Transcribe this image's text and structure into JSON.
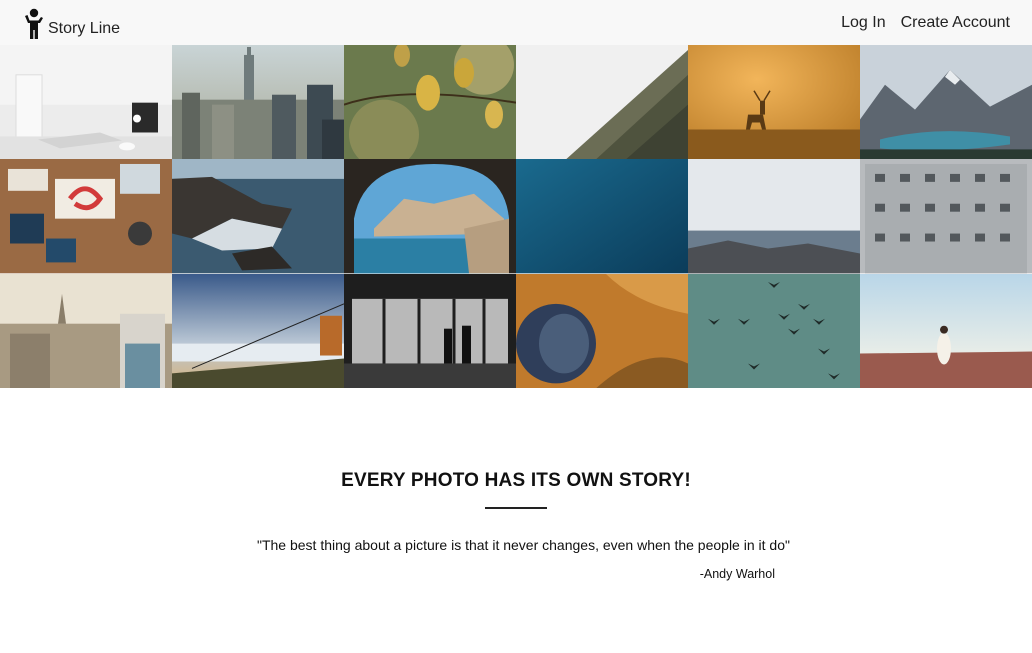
{
  "brand": {
    "name": "Story Line",
    "icon": "person-raising-arm-icon"
  },
  "nav": {
    "login": "Log In",
    "create_account": "Create Account"
  },
  "gallery": {
    "photos": [
      "laptop-on-white-desk",
      "city-skyline-sunrise",
      "autumn-leaves-branch",
      "misty-forest-hillside",
      "deer-in-golden-fog",
      "mountain-lake-valley",
      "design-tools-on-wood-table",
      "rocky-sea-cliffs-waves",
      "sea-cave-arch",
      "deep-blue-water",
      "rocky-coast-overcast",
      "weathered-apartment-building",
      "town-rooftops-sunset",
      "ski-lift-above-clouds",
      "window-silhouettes-bw",
      "orange-crater-aerial",
      "birds-in-teal-sky",
      "woman-on-red-desert"
    ]
  },
  "story": {
    "headline": "EVERY PHOTO HAS ITS OWN STORY!",
    "quote": "\"The best thing about a picture is that it never changes, even when the people in it do\"",
    "author": "-Andy Warhol"
  }
}
